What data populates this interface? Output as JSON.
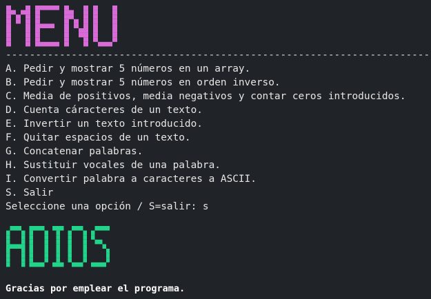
{
  "banners": {
    "menu": {
      "text": "MENU",
      "color": "#d96bd9"
    },
    "adios": {
      "text": "ADIOS",
      "color": "#22d38a"
    }
  },
  "divider": "-------------------------------------------------------------------------",
  "menu_items": [
    "A. Pedir y mostrar 5 números en un array.",
    "B. Pedir y mostrar 5 números en orden inverso.",
    "C. Media de positivos, media negativos y contar ceros introducidos.",
    "D. Cuenta cáracteres de un texto.",
    "E. Invertir un texto introducido.",
    "F. Quitar espacios de un texto.",
    "G. Concatenar palabras.",
    "H. Sustituir vocales de una palabra.",
    "I. Convertir palabra a caracteres a ASCII.",
    "S. Salir"
  ],
  "prompt": "Seleccione una opción / S=salir: s",
  "farewell": "Gracias por emplear el programa."
}
